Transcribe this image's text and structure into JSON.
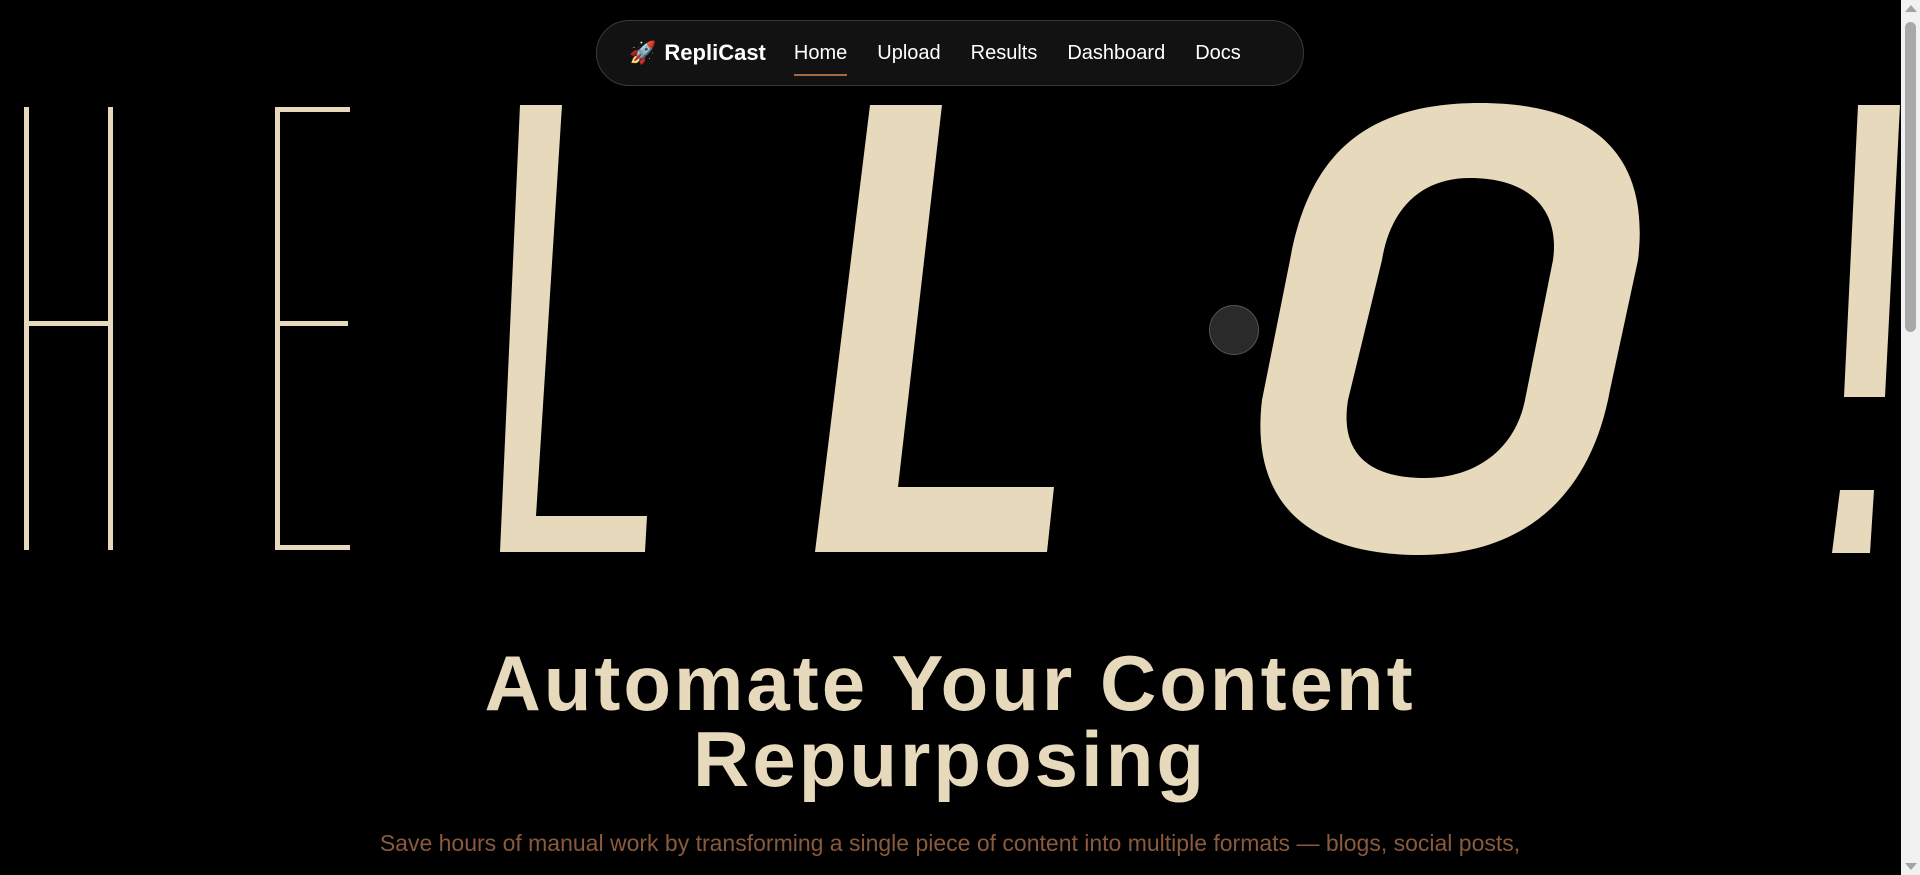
{
  "nav": {
    "brand_icon": "🚀",
    "brand_name": "RepliCast",
    "links": [
      {
        "label": "Home",
        "active": true
      },
      {
        "label": "Upload",
        "active": false
      },
      {
        "label": "Results",
        "active": false
      },
      {
        "label": "Dashboard",
        "active": false
      },
      {
        "label": "Docs",
        "active": false
      }
    ]
  },
  "hero": {
    "letters": [
      "H",
      "E",
      "L",
      "L",
      "O",
      "!"
    ],
    "headline_line1": "Automate Your Content",
    "headline_line2": "Repurposing",
    "subtext": "Save hours of manual work by transforming a single piece of content into multiple formats — blogs, social posts,"
  },
  "colors": {
    "background": "#000000",
    "cream": "#e6d9bc",
    "accent": "#a56a43",
    "subtext": "#8a5a3c"
  },
  "icons": {
    "brand": "rocket-icon"
  }
}
